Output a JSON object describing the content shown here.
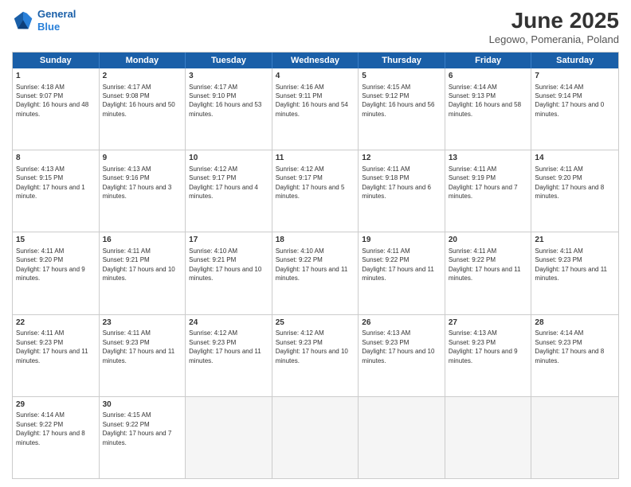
{
  "header": {
    "logo_line1": "General",
    "logo_line2": "Blue",
    "title": "June 2025",
    "subtitle": "Legowo, Pomerania, Poland"
  },
  "weekdays": [
    "Sunday",
    "Monday",
    "Tuesday",
    "Wednesday",
    "Thursday",
    "Friday",
    "Saturday"
  ],
  "rows": [
    [
      {
        "day": "1",
        "rise": "Sunrise: 4:18 AM",
        "set": "Sunset: 9:07 PM",
        "light": "Daylight: 16 hours and 48 minutes."
      },
      {
        "day": "2",
        "rise": "Sunrise: 4:17 AM",
        "set": "Sunset: 9:08 PM",
        "light": "Daylight: 16 hours and 50 minutes."
      },
      {
        "day": "3",
        "rise": "Sunrise: 4:17 AM",
        "set": "Sunset: 9:10 PM",
        "light": "Daylight: 16 hours and 53 minutes."
      },
      {
        "day": "4",
        "rise": "Sunrise: 4:16 AM",
        "set": "Sunset: 9:11 PM",
        "light": "Daylight: 16 hours and 54 minutes."
      },
      {
        "day": "5",
        "rise": "Sunrise: 4:15 AM",
        "set": "Sunset: 9:12 PM",
        "light": "Daylight: 16 hours and 56 minutes."
      },
      {
        "day": "6",
        "rise": "Sunrise: 4:14 AM",
        "set": "Sunset: 9:13 PM",
        "light": "Daylight: 16 hours and 58 minutes."
      },
      {
        "day": "7",
        "rise": "Sunrise: 4:14 AM",
        "set": "Sunset: 9:14 PM",
        "light": "Daylight: 17 hours and 0 minutes."
      }
    ],
    [
      {
        "day": "8",
        "rise": "Sunrise: 4:13 AM",
        "set": "Sunset: 9:15 PM",
        "light": "Daylight: 17 hours and 1 minute."
      },
      {
        "day": "9",
        "rise": "Sunrise: 4:13 AM",
        "set": "Sunset: 9:16 PM",
        "light": "Daylight: 17 hours and 3 minutes."
      },
      {
        "day": "10",
        "rise": "Sunrise: 4:12 AM",
        "set": "Sunset: 9:17 PM",
        "light": "Daylight: 17 hours and 4 minutes."
      },
      {
        "day": "11",
        "rise": "Sunrise: 4:12 AM",
        "set": "Sunset: 9:17 PM",
        "light": "Daylight: 17 hours and 5 minutes."
      },
      {
        "day": "12",
        "rise": "Sunrise: 4:11 AM",
        "set": "Sunset: 9:18 PM",
        "light": "Daylight: 17 hours and 6 minutes."
      },
      {
        "day": "13",
        "rise": "Sunrise: 4:11 AM",
        "set": "Sunset: 9:19 PM",
        "light": "Daylight: 17 hours and 7 minutes."
      },
      {
        "day": "14",
        "rise": "Sunrise: 4:11 AM",
        "set": "Sunset: 9:20 PM",
        "light": "Daylight: 17 hours and 8 minutes."
      }
    ],
    [
      {
        "day": "15",
        "rise": "Sunrise: 4:11 AM",
        "set": "Sunset: 9:20 PM",
        "light": "Daylight: 17 hours and 9 minutes."
      },
      {
        "day": "16",
        "rise": "Sunrise: 4:11 AM",
        "set": "Sunset: 9:21 PM",
        "light": "Daylight: 17 hours and 10 minutes."
      },
      {
        "day": "17",
        "rise": "Sunrise: 4:10 AM",
        "set": "Sunset: 9:21 PM",
        "light": "Daylight: 17 hours and 10 minutes."
      },
      {
        "day": "18",
        "rise": "Sunrise: 4:10 AM",
        "set": "Sunset: 9:22 PM",
        "light": "Daylight: 17 hours and 11 minutes."
      },
      {
        "day": "19",
        "rise": "Sunrise: 4:11 AM",
        "set": "Sunset: 9:22 PM",
        "light": "Daylight: 17 hours and 11 minutes."
      },
      {
        "day": "20",
        "rise": "Sunrise: 4:11 AM",
        "set": "Sunset: 9:22 PM",
        "light": "Daylight: 17 hours and 11 minutes."
      },
      {
        "day": "21",
        "rise": "Sunrise: 4:11 AM",
        "set": "Sunset: 9:23 PM",
        "light": "Daylight: 17 hours and 11 minutes."
      }
    ],
    [
      {
        "day": "22",
        "rise": "Sunrise: 4:11 AM",
        "set": "Sunset: 9:23 PM",
        "light": "Daylight: 17 hours and 11 minutes."
      },
      {
        "day": "23",
        "rise": "Sunrise: 4:11 AM",
        "set": "Sunset: 9:23 PM",
        "light": "Daylight: 17 hours and 11 minutes."
      },
      {
        "day": "24",
        "rise": "Sunrise: 4:12 AM",
        "set": "Sunset: 9:23 PM",
        "light": "Daylight: 17 hours and 11 minutes."
      },
      {
        "day": "25",
        "rise": "Sunrise: 4:12 AM",
        "set": "Sunset: 9:23 PM",
        "light": "Daylight: 17 hours and 10 minutes."
      },
      {
        "day": "26",
        "rise": "Sunrise: 4:13 AM",
        "set": "Sunset: 9:23 PM",
        "light": "Daylight: 17 hours and 10 minutes."
      },
      {
        "day": "27",
        "rise": "Sunrise: 4:13 AM",
        "set": "Sunset: 9:23 PM",
        "light": "Daylight: 17 hours and 9 minutes."
      },
      {
        "day": "28",
        "rise": "Sunrise: 4:14 AM",
        "set": "Sunset: 9:23 PM",
        "light": "Daylight: 17 hours and 8 minutes."
      }
    ],
    [
      {
        "day": "29",
        "rise": "Sunrise: 4:14 AM",
        "set": "Sunset: 9:22 PM",
        "light": "Daylight: 17 hours and 8 minutes."
      },
      {
        "day": "30",
        "rise": "Sunrise: 4:15 AM",
        "set": "Sunset: 9:22 PM",
        "light": "Daylight: 17 hours and 7 minutes."
      },
      null,
      null,
      null,
      null,
      null
    ]
  ]
}
